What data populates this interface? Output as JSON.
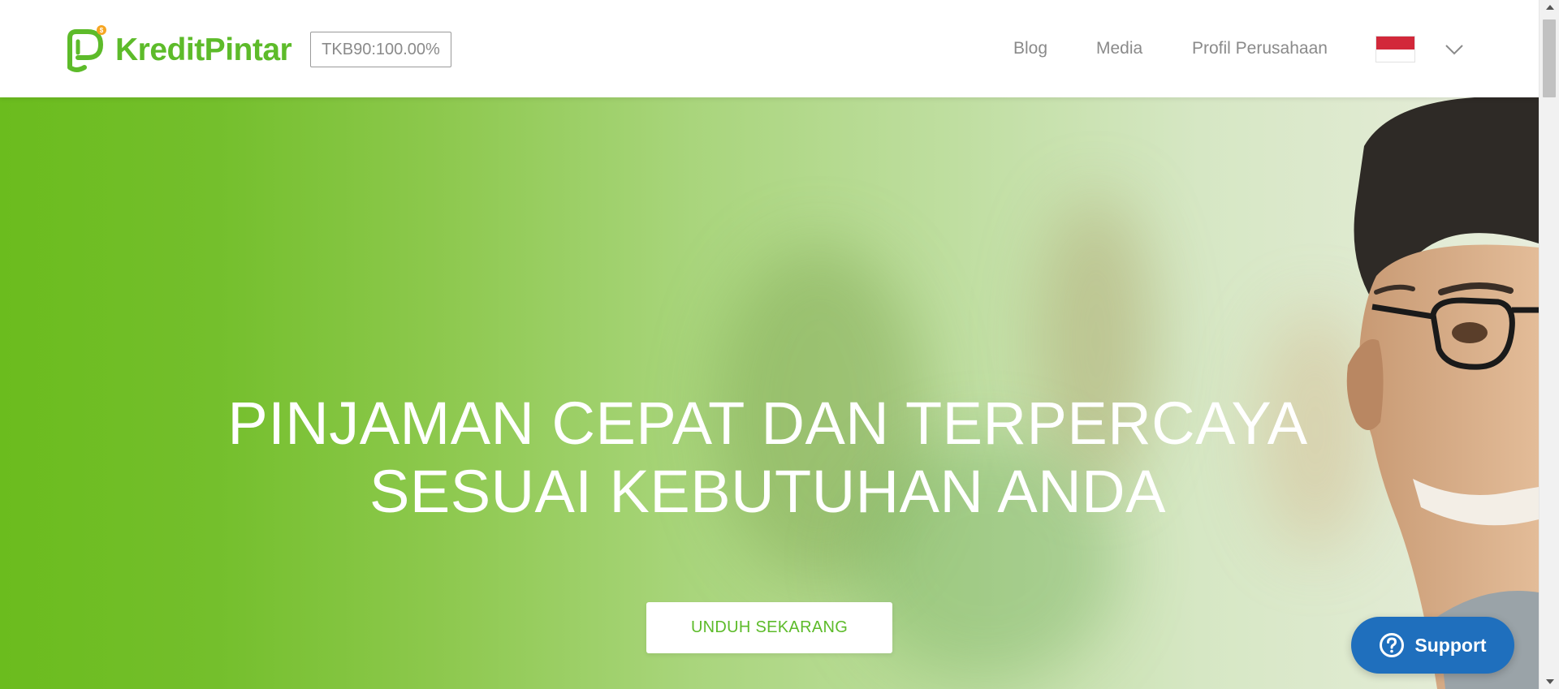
{
  "header": {
    "brand": "KreditPintar",
    "brand_color": "#5dbb2a",
    "tkb_badge": "TKB90:100.00%",
    "nav": [
      {
        "label": "Blog"
      },
      {
        "label": "Media"
      },
      {
        "label": "Profil Perusahaan"
      }
    ],
    "language": {
      "flag": "indonesia-flag-icon",
      "chevron": "chevron-down-icon"
    }
  },
  "hero": {
    "headline_line1": "PINJAMAN CEPAT DAN TERPERCAYA",
    "headline_line2": "SESUAI KEBUTUHAN ANDA",
    "cta_label": "UNDUH SEKARANG",
    "background_color": "#6bbc1e"
  },
  "support": {
    "label": "Support",
    "icon": "question-circle-icon",
    "color": "#1f6fbd"
  }
}
